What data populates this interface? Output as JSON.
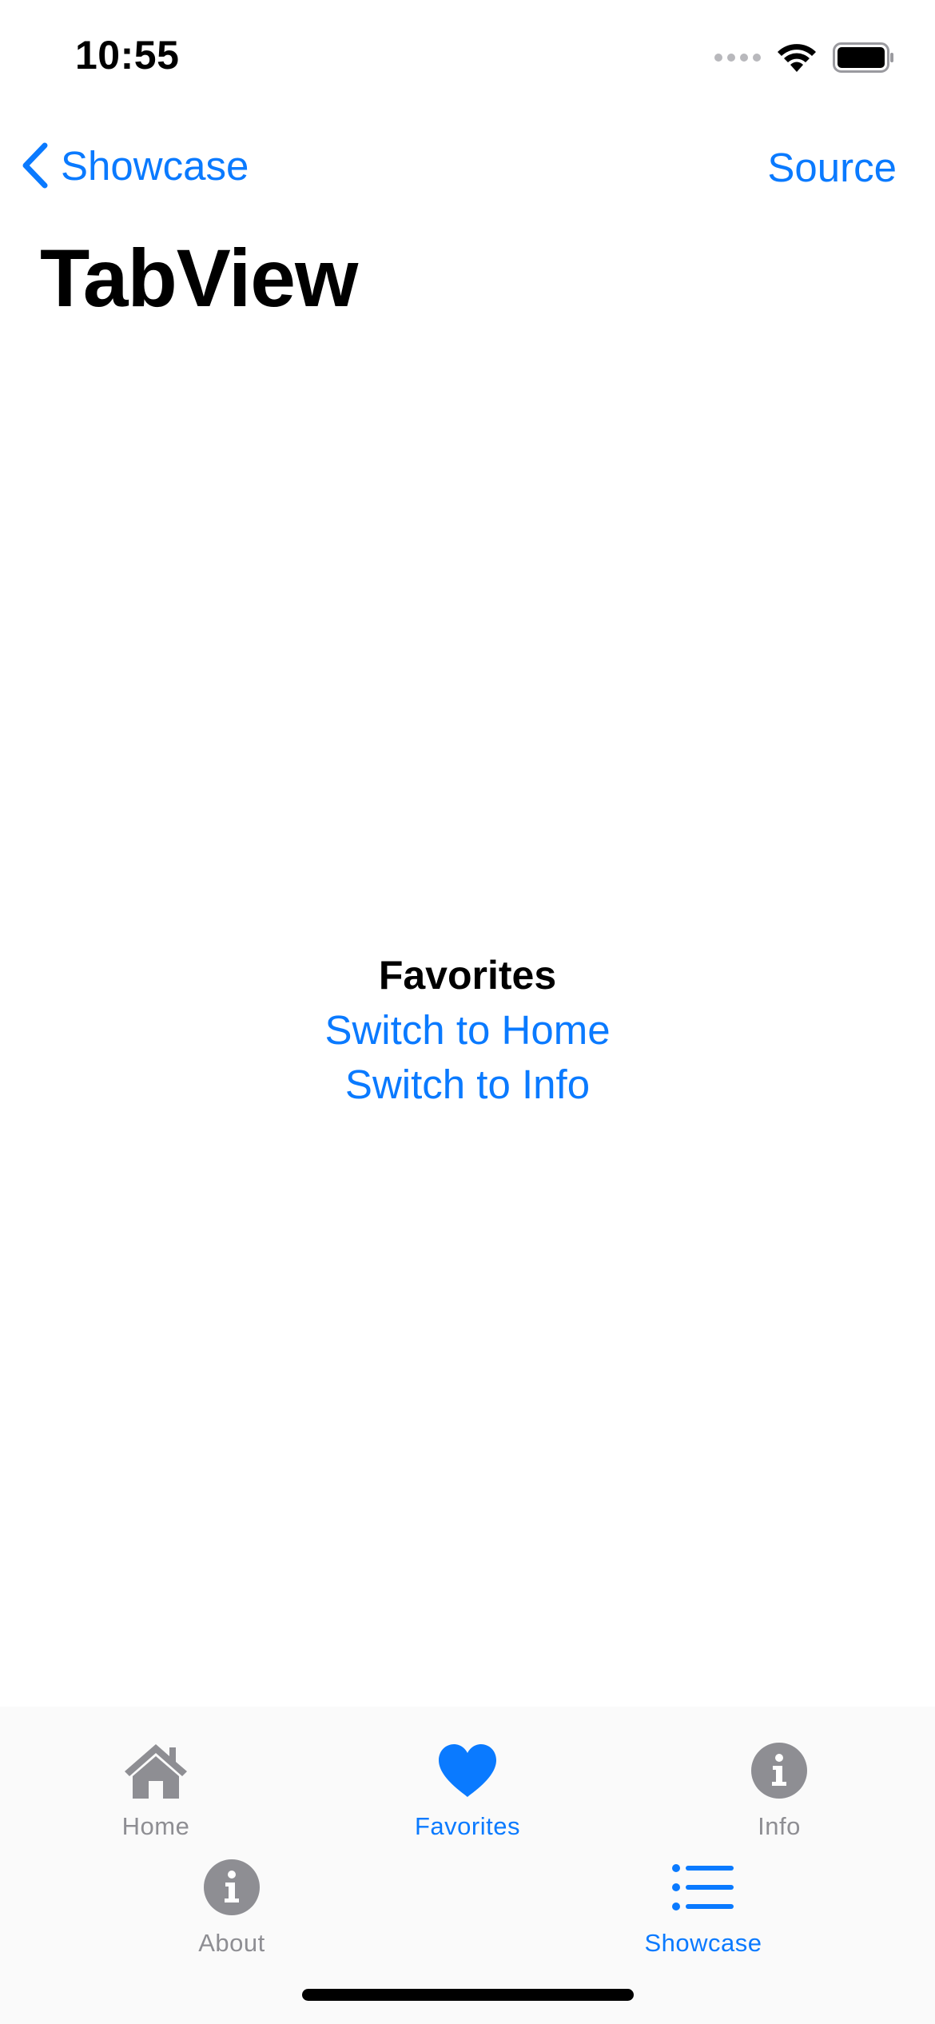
{
  "status_bar": {
    "time": "10:55"
  },
  "nav": {
    "back_label": "Showcase",
    "source_label": "Source",
    "title": "TabView"
  },
  "content": {
    "heading": "Favorites",
    "link_home": "Switch to Home",
    "link_info": "Switch to Info"
  },
  "tab_bar": {
    "items": [
      {
        "label": "Home",
        "icon": "house-icon",
        "active": false
      },
      {
        "label": "Favorites",
        "icon": "heart-icon",
        "active": true
      },
      {
        "label": "Info",
        "icon": "info-circle-icon",
        "active": false
      },
      {
        "label": "About",
        "icon": "info-circle-icon",
        "active": false
      },
      {
        "label": "Showcase",
        "icon": "list-icon",
        "active": false
      }
    ]
  },
  "colors": {
    "accent": "#0a7aff",
    "inactive": "#8e8e93",
    "text": "#000000",
    "background": "#ffffff"
  }
}
